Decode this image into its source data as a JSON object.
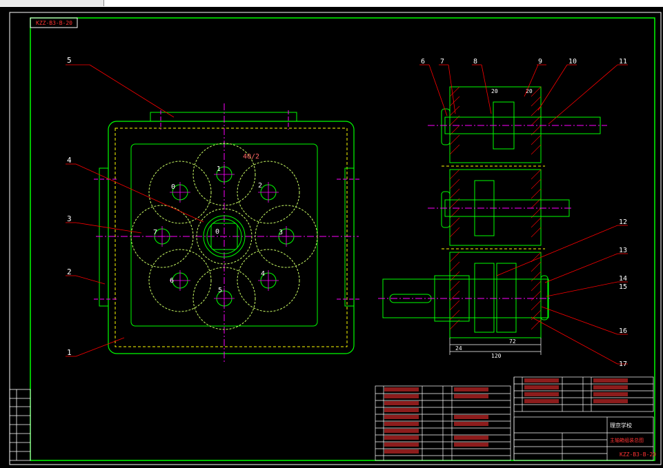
{
  "drawing": {
    "code": "KZZ-B3-B-20",
    "title_block": {
      "school": "理京学校",
      "name": "主轴箱组装总图",
      "code": "KZZ-B3-B-20"
    },
    "callouts": [
      "1",
      "2",
      "3",
      "4",
      "5",
      "6",
      "7",
      "8",
      "9",
      "10",
      "11",
      "12",
      "13",
      "14",
      "15",
      "16",
      "17"
    ],
    "gear_labels": [
      "0",
      "1",
      "2",
      "3",
      "4",
      "5",
      "6",
      "7"
    ],
    "dimension_top": "40/2",
    "dims_right": [
      "24",
      "72",
      "120",
      "20",
      "20"
    ]
  },
  "colors": {
    "background": "#000000",
    "outline": "#00ff00",
    "leader": "#ff0000",
    "center": "#ff00ff",
    "text": "#ffffff",
    "yellow": "#ffff00",
    "gear": "#ccff66"
  }
}
